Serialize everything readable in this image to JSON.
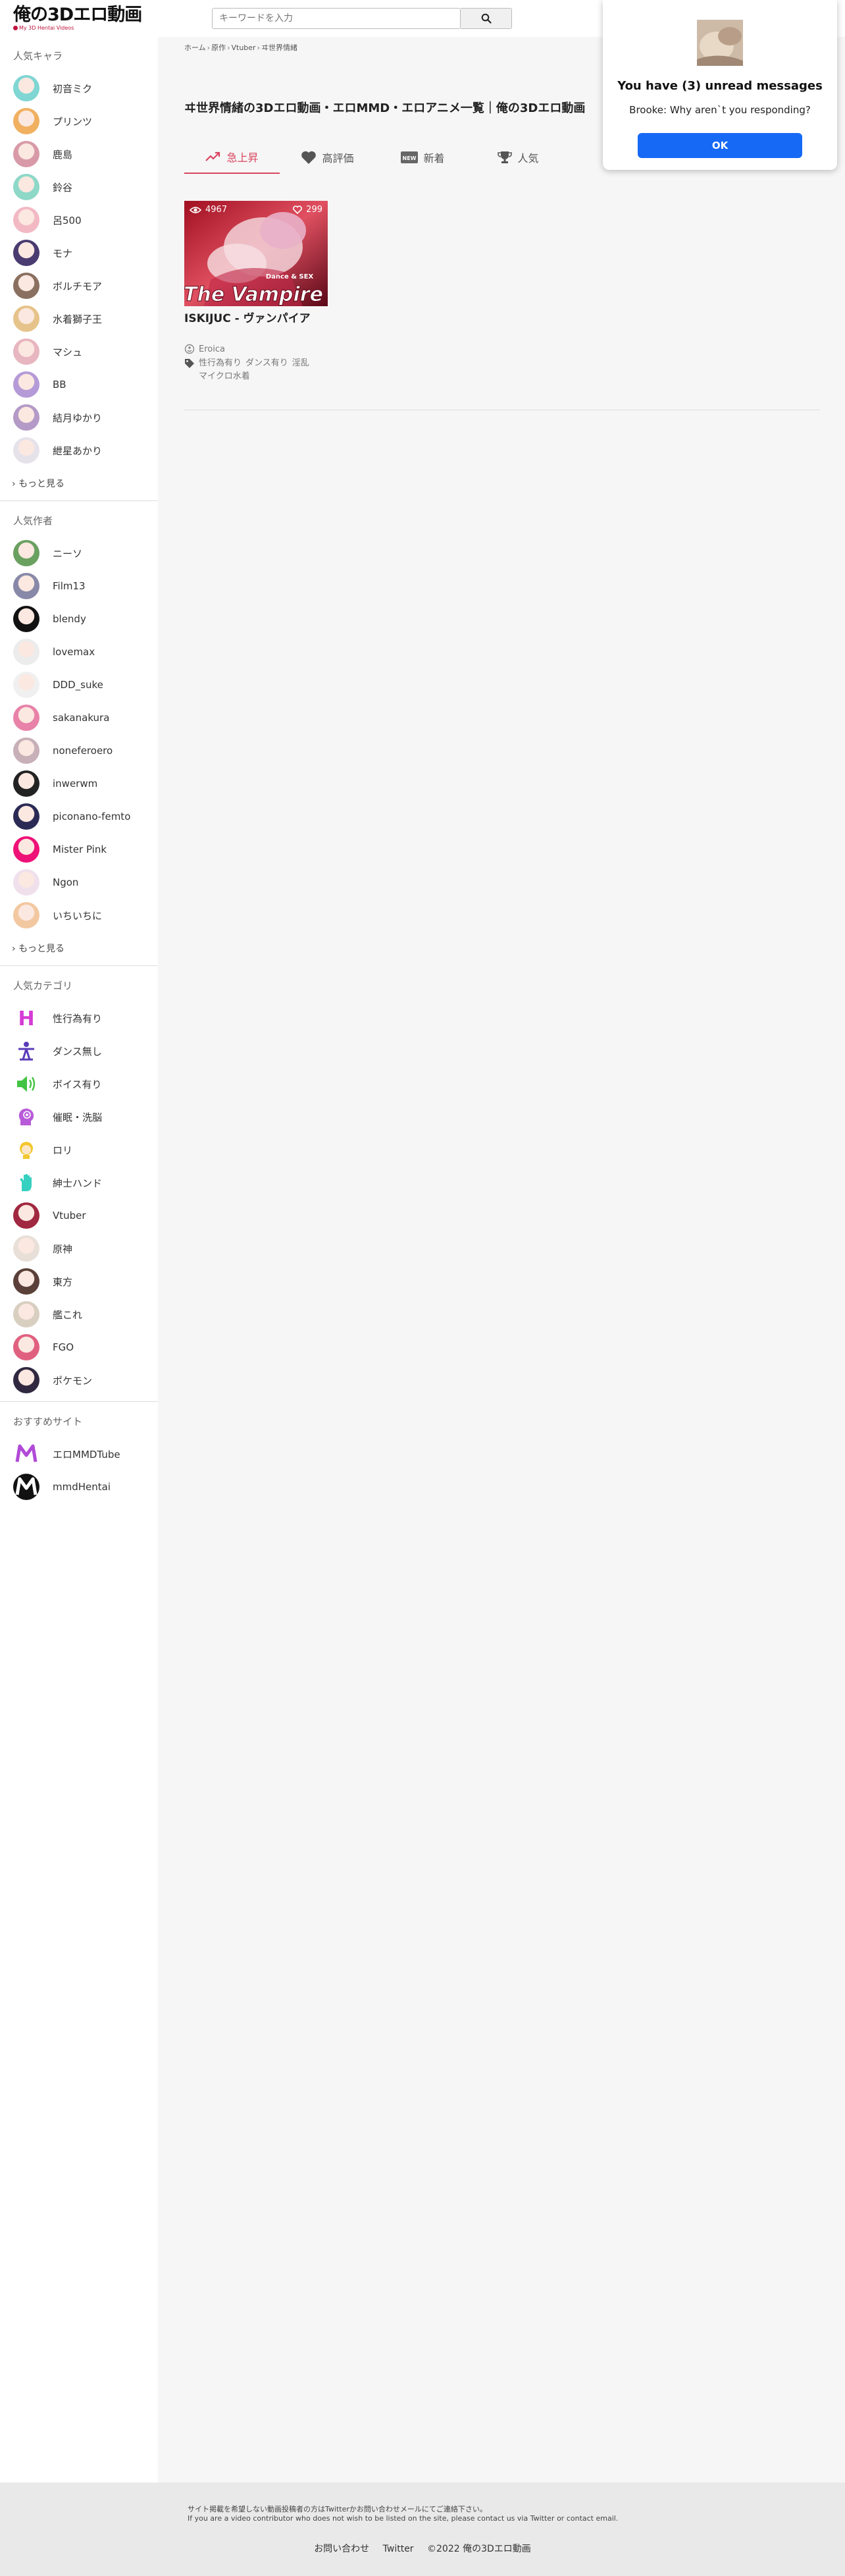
{
  "header": {
    "logo_text": "俺の3Dエロ動画",
    "logo_sub": "My 3D Hentai Videos",
    "search_placeholder": "キーワードを入力"
  },
  "sidebar": {
    "characters_title": "人気キャラ",
    "characters": [
      {
        "label": "初音ミク",
        "color": "#7fd6d3"
      },
      {
        "label": "プリンツ",
        "color": "#f0b060"
      },
      {
        "label": "鹿島",
        "color": "#d89aa8"
      },
      {
        "label": "鈴谷",
        "color": "#8ed8c8"
      },
      {
        "label": "呂500",
        "color": "#f2b9c4"
      },
      {
        "label": "モナ",
        "color": "#4a3b70"
      },
      {
        "label": "ボルチモア",
        "color": "#8a7060"
      },
      {
        "label": "水着獅子王",
        "color": "#e6c38a"
      },
      {
        "label": "マシュ",
        "color": "#e8b6c0"
      },
      {
        "label": "BB",
        "color": "#b59ad8"
      },
      {
        "label": "結月ゆかり",
        "color": "#b49ac6"
      },
      {
        "label": "紲星あかり",
        "color": "#e6e2ea"
      }
    ],
    "more_label": "もっと見る",
    "creators_title": "人気作者",
    "creators": [
      {
        "label": "ニーソ",
        "color": "#6aa060"
      },
      {
        "label": "Film13",
        "color": "#8888a8"
      },
      {
        "label": "blendy",
        "color": "#111111"
      },
      {
        "label": "lovemax",
        "color": "#ececec"
      },
      {
        "label": "DDD_suke",
        "color": "#f0f0f0"
      },
      {
        "label": "sakanakura",
        "color": "#e882a8"
      },
      {
        "label": "noneferoero",
        "color": "#c8b0b8"
      },
      {
        "label": "inwerwm",
        "color": "#222222"
      },
      {
        "label": "piconano-femto",
        "color": "#2b2a55"
      },
      {
        "label": "Mister Pink",
        "color": "#ee1177"
      },
      {
        "label": "Ngon",
        "color": "#f0e0ec"
      },
      {
        "label": "いちいちに",
        "color": "#f2c8a0"
      }
    ],
    "categories_title": "人気カテゴリ",
    "categories": [
      {
        "label": "性行為有り",
        "icon": "h-icon",
        "color": "#d63bd6"
      },
      {
        "label": "ダンス無し",
        "icon": "dance-icon",
        "color": "#5a3bb8"
      },
      {
        "label": "ボイス有り",
        "icon": "voice-icon",
        "color": "#42c442"
      },
      {
        "label": "催眠・洗脳",
        "icon": "hypnosis-icon",
        "color": "#b85bd8"
      },
      {
        "label": "ロリ",
        "icon": "loli-icon",
        "color": "#f2c830"
      },
      {
        "label": "紳士ハンド",
        "icon": "hand-icon",
        "color": "#36d0c0"
      },
      {
        "label": "Vtuber",
        "icon": "vtuber-avatar",
        "color": "#a02840"
      },
      {
        "label": "原神",
        "icon": "genshin-avatar",
        "color": "#e8e0d8"
      },
      {
        "label": "東方",
        "icon": "touhou-avatar",
        "color": "#5a4038"
      },
      {
        "label": "艦これ",
        "icon": "kancolle-avatar",
        "color": "#d8cfc0"
      },
      {
        "label": "FGO",
        "icon": "fgo-avatar",
        "color": "#e06080"
      },
      {
        "label": "ポケモン",
        "icon": "pokemon-avatar",
        "color": "#302840"
      }
    ],
    "sites_title": "おすすめサイト",
    "sites": [
      {
        "label": "エロMMDTube",
        "color": "#b04ad8"
      },
      {
        "label": "mmdHentai",
        "color": "#111111"
      }
    ]
  },
  "main": {
    "breadcrumb": [
      "ホーム",
      "原作",
      "Vtuber",
      "ヰ世界情緒"
    ],
    "page_title": "ヰ世界情緒の3Dエロ動画・エロMMD・エロアニメ一覧｜俺の3Dエロ動画",
    "tabs": [
      {
        "label": "急上昇",
        "icon": "trending-icon",
        "active": true
      },
      {
        "label": "高評価",
        "icon": "heart-icon",
        "active": false
      },
      {
        "label": "新着",
        "icon": "new-icon",
        "active": false
      },
      {
        "label": "人気",
        "icon": "trophy-icon",
        "active": false
      }
    ],
    "video": {
      "views": "4967",
      "likes": "299",
      "thumb_text": "The Vampire",
      "thumb_sub": "Dance & SEX",
      "title": "ISKIJUC - ヴァンパイア",
      "author": "Eroica",
      "tags": [
        "性行為有り",
        "ダンス有り",
        "淫乱",
        "マイクロ水着"
      ]
    }
  },
  "popup": {
    "title": "You have (3) unread messages",
    "message": "Brooke: Why aren`t you responding?",
    "ok_label": "OK"
  },
  "footer": {
    "note_jp": "サイト掲載を希望しない動画投稿者の方はTwitterかお問い合わせメールにてご連絡下さい。",
    "note_en": "If you are a video contributor who does not wish to be listed on the site, please contact us via Twitter or contact email.",
    "links": [
      "お問い合わせ",
      "Twitter",
      "©2022 俺の3Dエロ動画"
    ]
  }
}
